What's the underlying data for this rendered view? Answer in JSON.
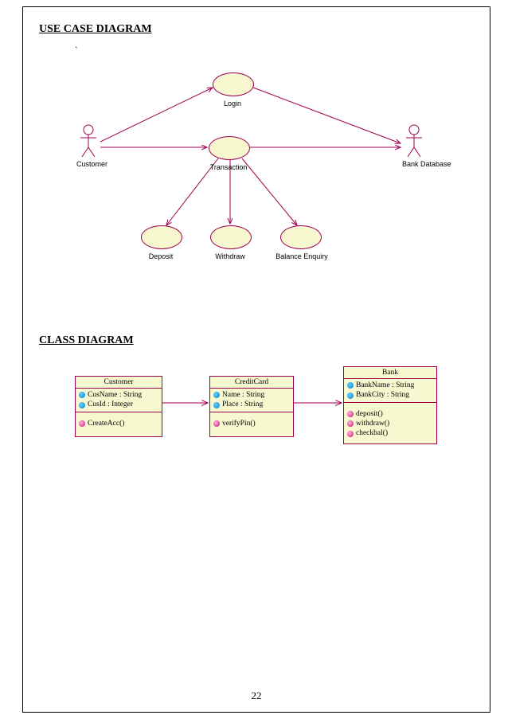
{
  "headings": {
    "usecase": "USE CASE DIAGRAM",
    "class": "CLASS DIAGRAM"
  },
  "pageNumber": "22",
  "usecase": {
    "actors": {
      "customer": "Customer",
      "bankdb": "Bank Database"
    },
    "cases": {
      "login": "Login",
      "transaction": "Transaction",
      "deposit": "Deposit",
      "withdraw": "Withdraw",
      "balance": "Balance Enquiry"
    },
    "relations": [
      {
        "from": "Customer",
        "to": "Login"
      },
      {
        "from": "Customer",
        "to": "Transaction"
      },
      {
        "from": "Login",
        "to": "Bank Database"
      },
      {
        "from": "Transaction",
        "to": "Bank Database"
      },
      {
        "from": "Transaction",
        "to": "Deposit"
      },
      {
        "from": "Transaction",
        "to": "Withdraw"
      },
      {
        "from": "Transaction",
        "to": "Balance Enquiry"
      }
    ]
  },
  "classes": {
    "customer": {
      "name": "Customer",
      "attrs": [
        "CusName : String",
        "CusId : Integer"
      ],
      "ops": [
        "CreateAcc()"
      ]
    },
    "creditcard": {
      "name": "CreditCard",
      "attrs": [
        "Name : String",
        "Place : String"
      ],
      "ops": [
        "verifyPin()"
      ]
    },
    "bank": {
      "name": "Bank",
      "attrs": [
        "BankName : String",
        "BankCity : String"
      ],
      "ops": [
        "deposit()",
        "withdraw()",
        "checkbal()"
      ]
    },
    "relations": [
      {
        "from": "Customer",
        "to": "CreditCard"
      },
      {
        "from": "CreditCard",
        "to": "Bank"
      }
    ]
  },
  "colors": {
    "stroke": "#a00050",
    "fill": "#f8f8d0"
  }
}
